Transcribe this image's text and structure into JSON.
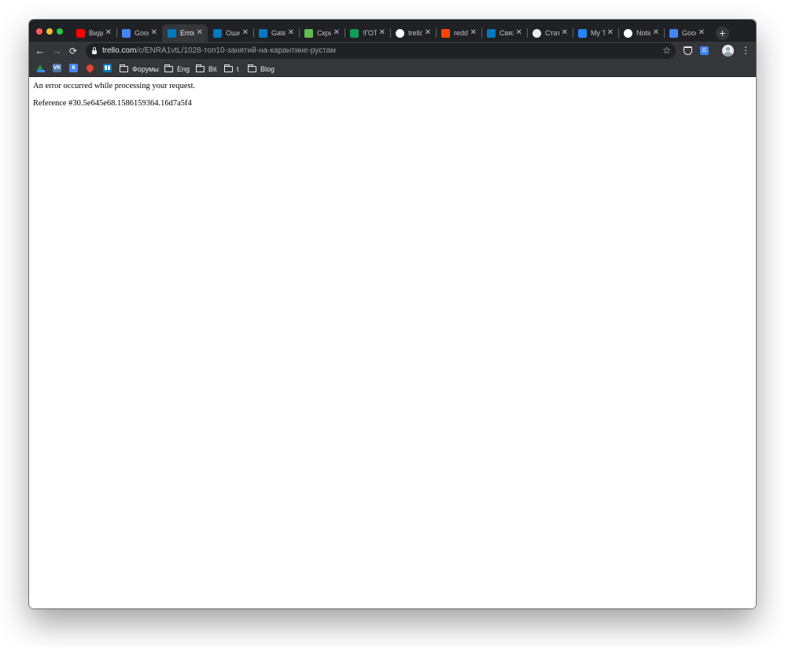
{
  "browser": {
    "tabs": [
      {
        "label": "Видео",
        "icon": "youtube-icon",
        "color": "#ff0000"
      },
      {
        "label": "Google",
        "icon": "google-calendar-icon",
        "color": "#4285f4"
      },
      {
        "label": "Error",
        "icon": "trello-icon",
        "color": "#0079bf",
        "active": true
      },
      {
        "label": "Ошибка",
        "icon": "trello-icon",
        "color": "#0079bf"
      },
      {
        "label": "Gateway",
        "icon": "trello-icon",
        "color": "#0079bf"
      },
      {
        "label": "Скрипты",
        "icon": "trello-green-icon",
        "color": "#61bd4f"
      },
      {
        "label": "!ГОТОВО",
        "icon": "google-drive-icon",
        "color": "#0f9d58"
      },
      {
        "label": "trello",
        "icon": "google-icon",
        "color": "#ffffff"
      },
      {
        "label": "reddit",
        "icon": "reddit-icon",
        "color": "#ff4500"
      },
      {
        "label": "Связи",
        "icon": "trello-icon",
        "color": "#0079bf"
      },
      {
        "label": "Статус",
        "icon": "clock-icon",
        "color": "#e8eaed"
      },
      {
        "label": "My Tasks",
        "icon": "atlassian-icon",
        "color": "#2684ff"
      },
      {
        "label": "Notion",
        "icon": "notion-icon",
        "color": "#ffffff"
      },
      {
        "label": "Google",
        "icon": "google-translate-icon",
        "color": "#4285f4"
      }
    ],
    "close_glyph": "✕",
    "newtab_glyph": "+",
    "nav": {
      "back": "←",
      "forward": "→",
      "reload": "C"
    },
    "url": {
      "host": "trello.com",
      "path": "/c/ENRA1vtL/1028-топ10-занятий-на-карантине-рустам"
    },
    "star_glyph": "☆",
    "menu_glyph": "⋮"
  },
  "bookmarks": {
    "icons": [
      "google-drive-icon",
      "vk-icon",
      "google-calendar-icon",
      "maps-pin-icon",
      "trello-icon"
    ],
    "vk_text": "VK",
    "cal_text": "6",
    "folders": [
      "Форумы",
      "Eng",
      "Bit",
      "t",
      "Blog"
    ]
  },
  "page": {
    "message": "An error occurred while processing your request.",
    "reference": "Reference #30.5e645e68.1586159364.16d7a5f4"
  }
}
